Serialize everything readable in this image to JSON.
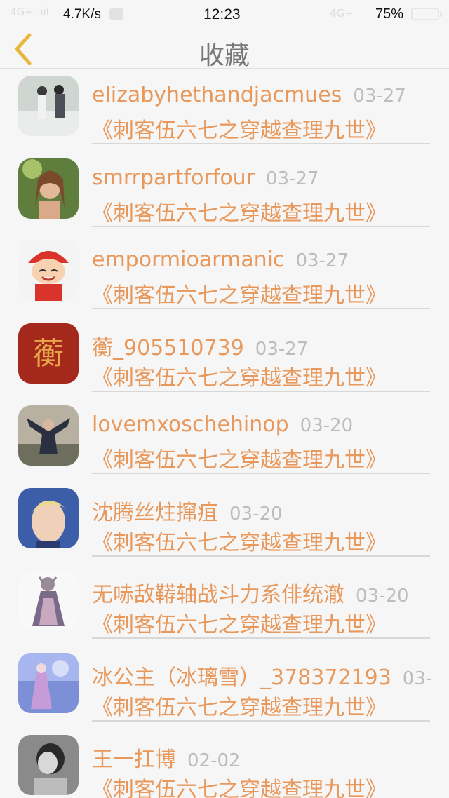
{
  "status": {
    "signal": "4G+ .ııl",
    "speed": "4.7K/s",
    "time": "12:23",
    "network": "4G+",
    "battery": "75%"
  },
  "nav": {
    "title": "收藏"
  },
  "items": [
    {
      "name": "elizabyhethandjacmues",
      "date": "03-27",
      "novel": "《刺客伍六七之穿越查理九世》",
      "avatar_color": "#9aa6a0"
    },
    {
      "name": "smrrpartforfour",
      "date": "03-27",
      "novel": "《刺客伍六七之穿越查理九世》",
      "avatar_color": "#6f8a4a"
    },
    {
      "name": "empormioarmanic",
      "date": "03-27",
      "novel": "《刺客伍六七之穿越查理九世》",
      "avatar_color": "#d94a3a"
    },
    {
      "name": "蘅_905510739",
      "date": "03-27",
      "novel": "《刺客伍六七之穿越查理九世》",
      "avatar_color": "#a4281c"
    },
    {
      "name": "lovemxoschehinop",
      "date": "03-20",
      "novel": "《刺客伍六七之穿越查理九世》",
      "avatar_color": "#7a8a8a"
    },
    {
      "name": "沈腾丝炷撺疽",
      "date": "03-20",
      "novel": "《刺客伍六七之穿越查理九世》",
      "avatar_color": "#3c5da8"
    },
    {
      "name": "无哧敌鞯轴战斗力系俳统澈",
      "date": "03-20",
      "novel": "《刺客伍六七之穿越查理九世》",
      "avatar_color": "#8c7a9a"
    },
    {
      "name": "冰公主（冰璃雪）_378372193",
      "date": "03-",
      "novel": "《刺客伍六七之穿越查理九世》",
      "avatar_color": "#5a6fbf"
    },
    {
      "name": "王一扛博",
      "date": "02-02",
      "novel": "《刺客伍六七之穿越查理九世》",
      "avatar_color": "#7a7a7a"
    }
  ]
}
